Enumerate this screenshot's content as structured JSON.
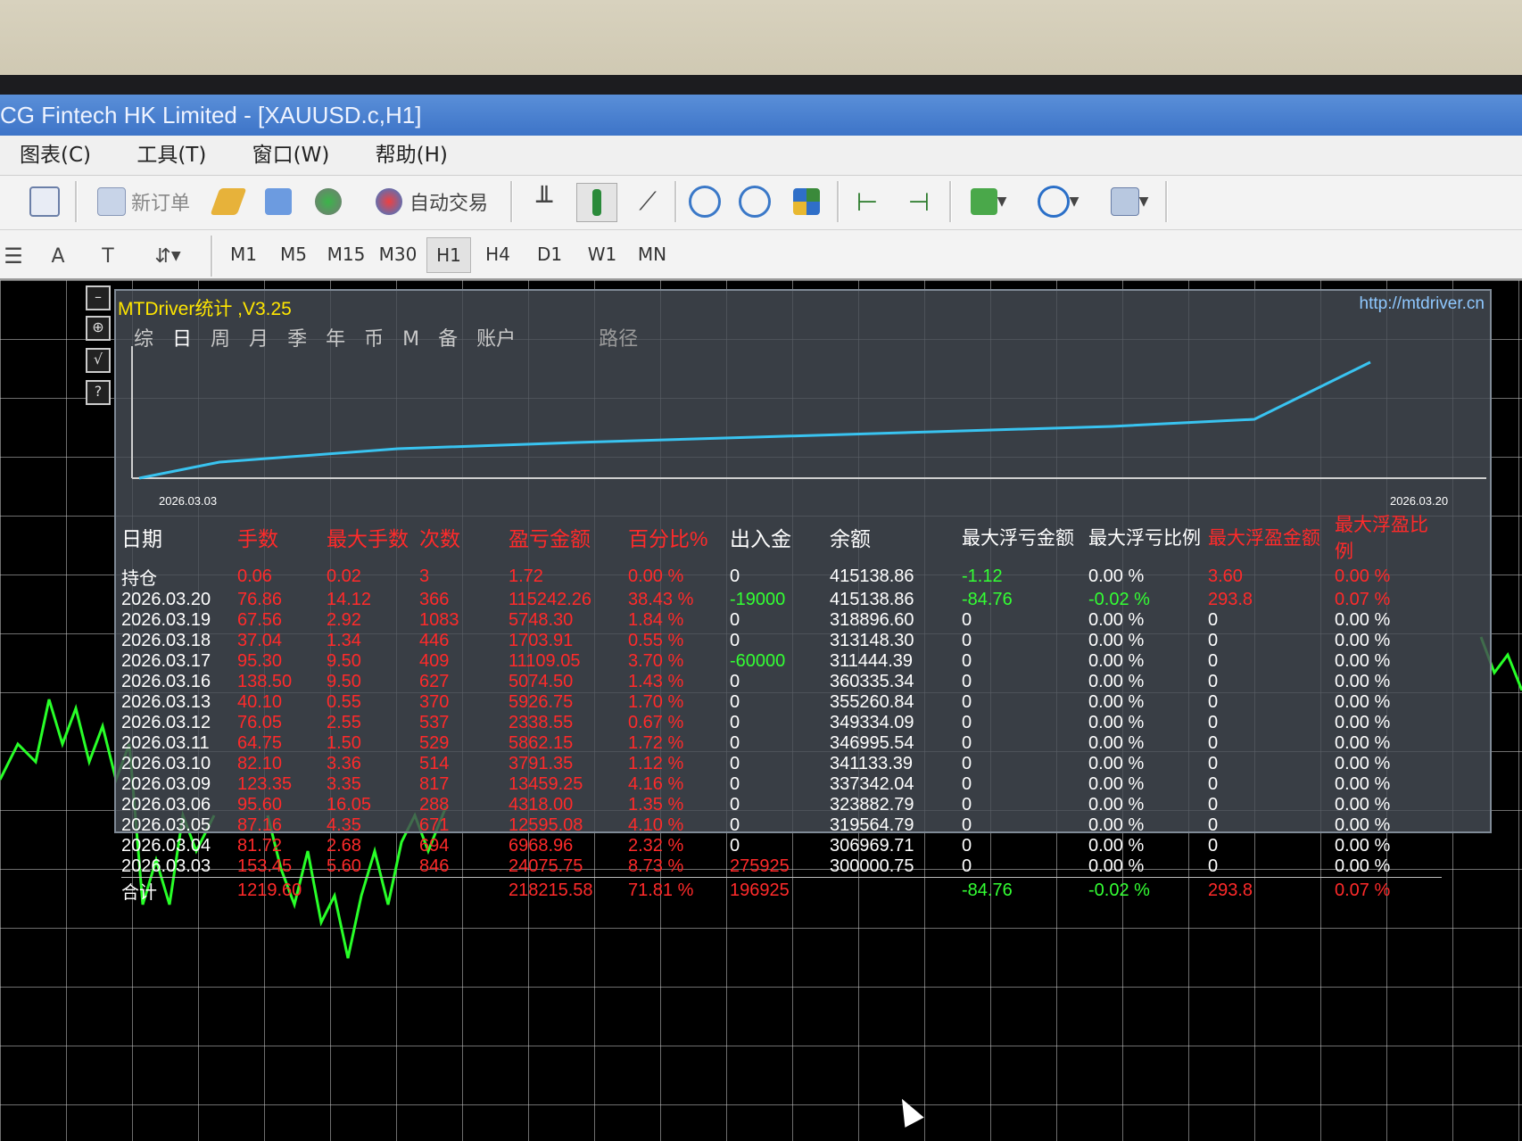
{
  "window": {
    "title": "CG Fintech HK Limited - [XAUUSD.c,H1]"
  },
  "menu": {
    "items": [
      "图表(C)",
      "工具(T)",
      "窗口(W)",
      "帮助(H)"
    ]
  },
  "toolbar": {
    "new_order": "新订单",
    "auto_trade": "自动交易"
  },
  "timeframes": {
    "items": [
      "M1",
      "M5",
      "M15",
      "M30",
      "H1",
      "H4",
      "D1",
      "W1",
      "MN"
    ],
    "active": "H1"
  },
  "panel": {
    "title": "MTDriver统计 ,V3.25",
    "url": "http://mtdriver.cn",
    "tabs": [
      "综",
      "日",
      "周",
      "月",
      "季",
      "年",
      "币",
      "M",
      "备",
      "账户"
    ],
    "path_label": "路径",
    "equity_chart": {
      "start_date": "2026.03.03",
      "end_date": "2026.03.20",
      "line_color": "#39c3f0"
    },
    "columns": [
      "日期",
      "手数",
      "最大手数",
      "次数",
      "盈亏金额",
      "百分比%",
      "出入金",
      "余额",
      "最大浮亏金额",
      "最大浮亏比例",
      "最大浮盈金额",
      "最大浮盈比例"
    ],
    "open_row": {
      "date": "持仓",
      "lots": "0.06",
      "max_lots": "0.02",
      "count": "3",
      "pl": "1.72",
      "pct": "0.00 %",
      "flow": "0",
      "balance": "415138.86",
      "max_float_loss": "-1.12",
      "max_float_loss_pct": "0.00 %",
      "max_float_profit": "3.60",
      "max_float_profit_pct": "0.00 %"
    },
    "rows": [
      {
        "date": "2026.03.20",
        "lots": "76.86",
        "max_lots": "14.12",
        "count": "366",
        "pl": "115242.26",
        "pct": "38.43 %",
        "flow": "-19000",
        "balance": "415138.86",
        "max_float_loss": "-84.76",
        "max_float_loss_pct": "-0.02 %",
        "max_float_profit": "293.8",
        "max_float_profit_pct": "0.07 %"
      },
      {
        "date": "2026.03.19",
        "lots": "67.56",
        "max_lots": "2.92",
        "count": "1083",
        "pl": "5748.30",
        "pct": "1.84 %",
        "flow": "0",
        "balance": "318896.60",
        "max_float_loss": "0",
        "max_float_loss_pct": "0.00 %",
        "max_float_profit": "0",
        "max_float_profit_pct": "0.00 %"
      },
      {
        "date": "2026.03.18",
        "lots": "37.04",
        "max_lots": "1.34",
        "count": "446",
        "pl": "1703.91",
        "pct": "0.55 %",
        "flow": "0",
        "balance": "313148.30",
        "max_float_loss": "0",
        "max_float_loss_pct": "0.00 %",
        "max_float_profit": "0",
        "max_float_profit_pct": "0.00 %"
      },
      {
        "date": "2026.03.17",
        "lots": "95.30",
        "max_lots": "9.50",
        "count": "409",
        "pl": "11109.05",
        "pct": "3.70 %",
        "flow": "-60000",
        "balance": "311444.39",
        "max_float_loss": "0",
        "max_float_loss_pct": "0.00 %",
        "max_float_profit": "0",
        "max_float_profit_pct": "0.00 %"
      },
      {
        "date": "2026.03.16",
        "lots": "138.50",
        "max_lots": "9.50",
        "count": "627",
        "pl": "5074.50",
        "pct": "1.43 %",
        "flow": "0",
        "balance": "360335.34",
        "max_float_loss": "0",
        "max_float_loss_pct": "0.00 %",
        "max_float_profit": "0",
        "max_float_profit_pct": "0.00 %"
      },
      {
        "date": "2026.03.13",
        "lots": "40.10",
        "max_lots": "0.55",
        "count": "370",
        "pl": "5926.75",
        "pct": "1.70 %",
        "flow": "0",
        "balance": "355260.84",
        "max_float_loss": "0",
        "max_float_loss_pct": "0.00 %",
        "max_float_profit": "0",
        "max_float_profit_pct": "0.00 %"
      },
      {
        "date": "2026.03.12",
        "lots": "76.05",
        "max_lots": "2.55",
        "count": "537",
        "pl": "2338.55",
        "pct": "0.67 %",
        "flow": "0",
        "balance": "349334.09",
        "max_float_loss": "0",
        "max_float_loss_pct": "0.00 %",
        "max_float_profit": "0",
        "max_float_profit_pct": "0.00 %"
      },
      {
        "date": "2026.03.11",
        "lots": "64.75",
        "max_lots": "1.50",
        "count": "529",
        "pl": "5862.15",
        "pct": "1.72 %",
        "flow": "0",
        "balance": "346995.54",
        "max_float_loss": "0",
        "max_float_loss_pct": "0.00 %",
        "max_float_profit": "0",
        "max_float_profit_pct": "0.00 %"
      },
      {
        "date": "2026.03.10",
        "lots": "82.10",
        "max_lots": "3.36",
        "count": "514",
        "pl": "3791.35",
        "pct": "1.12 %",
        "flow": "0",
        "balance": "341133.39",
        "max_float_loss": "0",
        "max_float_loss_pct": "0.00 %",
        "max_float_profit": "0",
        "max_float_profit_pct": "0.00 %"
      },
      {
        "date": "2026.03.09",
        "lots": "123.35",
        "max_lots": "3.35",
        "count": "817",
        "pl": "13459.25",
        "pct": "4.16 %",
        "flow": "0",
        "balance": "337342.04",
        "max_float_loss": "0",
        "max_float_loss_pct": "0.00 %",
        "max_float_profit": "0",
        "max_float_profit_pct": "0.00 %"
      },
      {
        "date": "2026.03.06",
        "lots": "95.60",
        "max_lots": "16.05",
        "count": "288",
        "pl": "4318.00",
        "pct": "1.35 %",
        "flow": "0",
        "balance": "323882.79",
        "max_float_loss": "0",
        "max_float_loss_pct": "0.00 %",
        "max_float_profit": "0",
        "max_float_profit_pct": "0.00 %"
      },
      {
        "date": "2026.03.05",
        "lots": "87.16",
        "max_lots": "4.35",
        "count": "671",
        "pl": "12595.08",
        "pct": "4.10 %",
        "flow": "0",
        "balance": "319564.79",
        "max_float_loss": "0",
        "max_float_loss_pct": "0.00 %",
        "max_float_profit": "0",
        "max_float_profit_pct": "0.00 %"
      },
      {
        "date": "2026.03.04",
        "lots": "81.72",
        "max_lots": "2.68",
        "count": "694",
        "pl": "6968.96",
        "pct": "2.32 %",
        "flow": "0",
        "balance": "306969.71",
        "max_float_loss": "0",
        "max_float_loss_pct": "0.00 %",
        "max_float_profit": "0",
        "max_float_profit_pct": "0.00 %"
      },
      {
        "date": "2026.03.03",
        "lots": "153.45",
        "max_lots": "5.60",
        "count": "846",
        "pl": "24075.75",
        "pct": "8.73 %",
        "flow": "275925",
        "balance": "300000.75",
        "max_float_loss": "0",
        "max_float_loss_pct": "0.00 %",
        "max_float_profit": "0",
        "max_float_profit_pct": "0.00 %"
      }
    ],
    "total_row": {
      "date": "合计",
      "lots": "1219.60",
      "pl": "218215.58",
      "pct": "71.81 %",
      "flow": "196925",
      "max_float_loss": "-84.76",
      "max_float_loss_pct": "-0.02 %",
      "max_float_profit": "293.8",
      "max_float_profit_pct": "0.07 %"
    }
  }
}
